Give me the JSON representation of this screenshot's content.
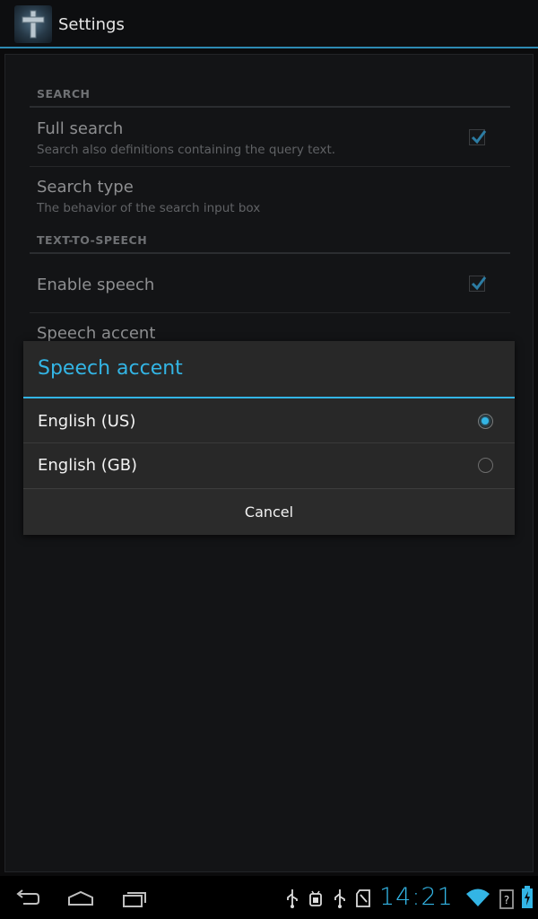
{
  "action_bar": {
    "title": "Settings",
    "app_icon": "cross-icon"
  },
  "preferences": {
    "search_category": "SEARCH",
    "full_search": {
      "title": "Full search",
      "summary": "Search also definitions containing the query text.",
      "checked": true
    },
    "search_type": {
      "title": "Search type",
      "summary": "The behavior of the search input box"
    },
    "tts_category": "TEXT-TO-SPEECH",
    "enable_speech": {
      "title": "Enable speech",
      "checked": true
    },
    "speech_accent": {
      "title": "Speech accent"
    }
  },
  "dialog": {
    "title": "Speech accent",
    "options": [
      {
        "label": "English (US)",
        "selected": true
      },
      {
        "label": "English (GB)",
        "selected": false
      }
    ],
    "cancel_label": "Cancel"
  },
  "system_bar": {
    "clock": "14:21",
    "nav_icons": [
      "back-icon",
      "home-icon",
      "recent-apps-icon"
    ],
    "status_icons": [
      "usb-icon",
      "android-debug-icon",
      "usb-icon",
      "sd-card-icon",
      "wifi-icon",
      "battery-unknown-icon",
      "battery-charging-icon"
    ]
  },
  "colors": {
    "accent": "#33b5e5",
    "dialog_bg": "#282828",
    "background": "#0b0b0c"
  }
}
